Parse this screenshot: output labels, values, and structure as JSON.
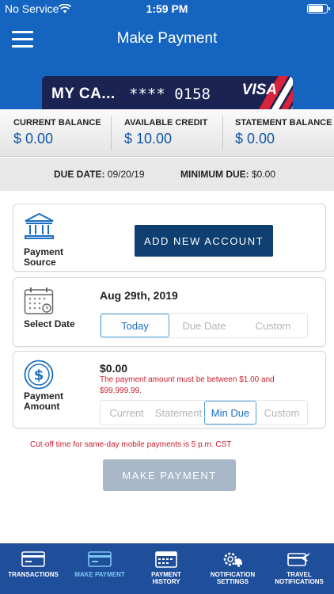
{
  "status": {
    "carrier": "No Service",
    "time": "1:59 PM"
  },
  "header": {
    "title": "Make Payment"
  },
  "card": {
    "name": "MY CA...",
    "masked": "**** 0158",
    "brand": "VISA"
  },
  "balances": [
    {
      "label": "CURRENT BALANCE",
      "value": "$ 0.00"
    },
    {
      "label": "AVAILABLE CREDIT",
      "value": "$ 10.00"
    },
    {
      "label": "STATEMENT BALANCE",
      "value": "$ 0.00"
    }
  ],
  "due": {
    "due_date_label": "DUE DATE:",
    "due_date": "09/20/19",
    "min_due_label": "MINIMUM DUE:",
    "min_due": "$0.00"
  },
  "payment_source": {
    "label_line1": "Payment",
    "label_line2": "Source",
    "button": "ADD NEW ACCOUNT"
  },
  "select_date": {
    "label": "Select Date",
    "date": "Aug 29th, 2019",
    "options": [
      "Today",
      "Due Date",
      "Custom"
    ],
    "selected": "Today"
  },
  "payment_amount": {
    "label_line1": "Payment",
    "label_line2": "Amount",
    "amount": "$0.00",
    "error_line1": "The payment amount must be between $1.00 and",
    "error_line2": "$99,999.99.",
    "options": [
      "Current",
      "Statement",
      "Min Due",
      "Custom"
    ],
    "selected": "Min Due"
  },
  "cutoff_note": "Cut-off time for same-day mobile payments is 5 p.m. CST",
  "make_payment_button": "MAKE PAYMENT",
  "tabs": [
    {
      "line1": "TRANSACTIONS",
      "line2": "",
      "icon": "card-icon"
    },
    {
      "line1": "MAKE PAYMENT",
      "line2": "",
      "icon": "card-icon"
    },
    {
      "line1": "PAYMENT",
      "line2": "HISTORY",
      "icon": "calendar-icon"
    },
    {
      "line1": "NOTIFICATION",
      "line2": "SETTINGS",
      "icon": "gear-bell-icon"
    },
    {
      "line1": "TRAVEL",
      "line2": "NOTIFICATIONS",
      "icon": "card-plane-icon"
    }
  ],
  "colors": {
    "header": "#1565c0",
    "tabbar": "#1f4f9b",
    "accent": "#1255a8",
    "error": "#cc1e2e",
    "active_tab": "#7cc7f5"
  }
}
